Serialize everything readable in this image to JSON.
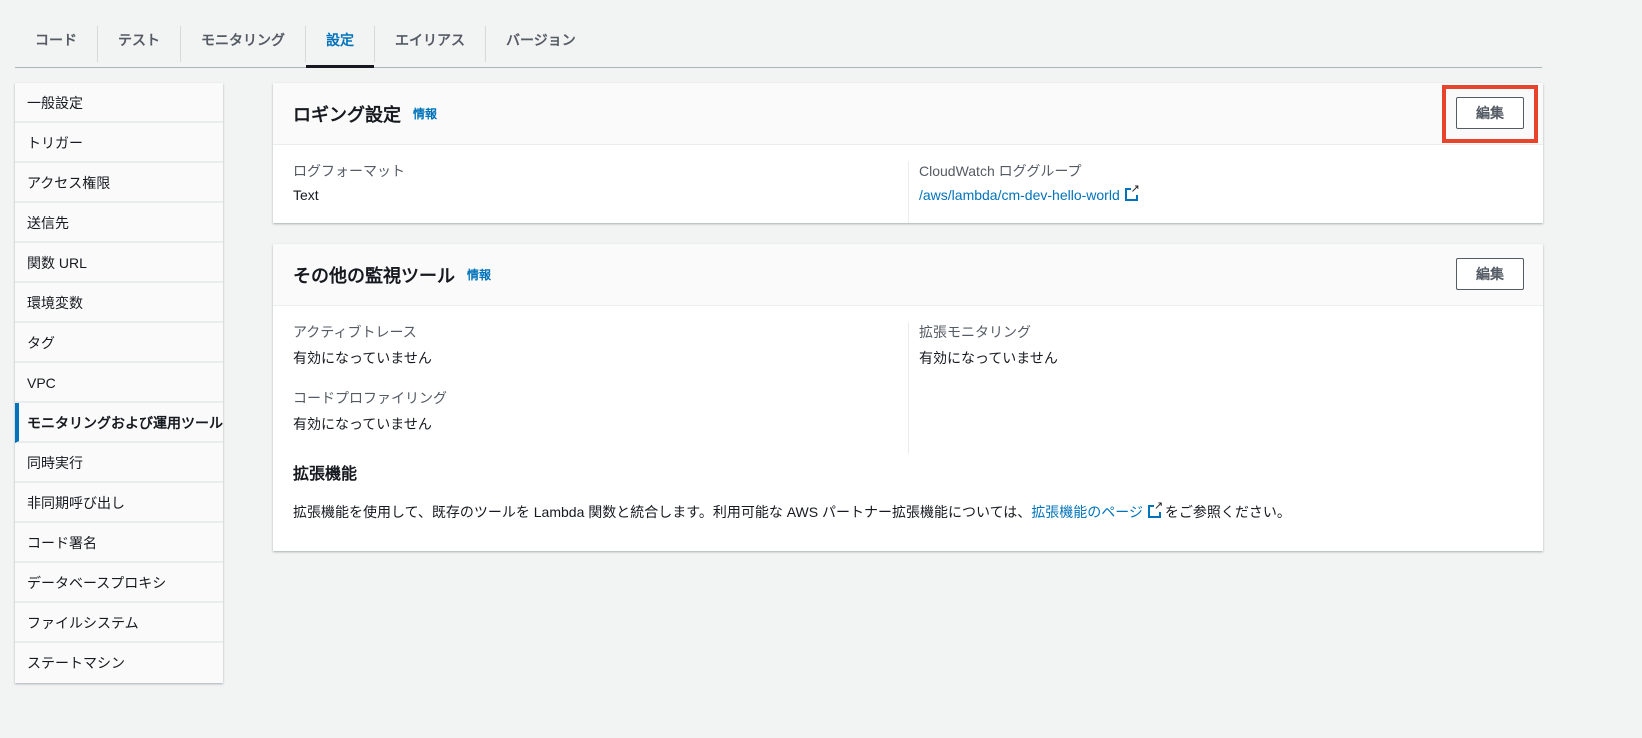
{
  "tabs": [
    "コード",
    "テスト",
    "モニタリング",
    "設定",
    "エイリアス",
    "バージョン"
  ],
  "active_tab": "設定",
  "sidebar": [
    "一般設定",
    "トリガー",
    "アクセス権限",
    "送信先",
    "関数 URL",
    "環境変数",
    "タグ",
    "VPC",
    "モニタリングおよび運用ツール",
    "同時実行",
    "非同期呼び出し",
    "コード署名",
    "データベースプロキシ",
    "ファイルシステム",
    "ステートマシン"
  ],
  "logging": {
    "title": "ロギング設定",
    "info": "情報",
    "edit": "編集",
    "format_label": "ログフォーマット",
    "format_value": "Text",
    "group_label": "CloudWatch ロググループ",
    "group_value": "/aws/lambda/cm-dev-hello-world"
  },
  "monitoring": {
    "title": "その他の監視ツール",
    "info": "情報",
    "edit": "編集",
    "trace_label": "アクティブトレース",
    "trace_value": "有効になっていません",
    "profiling_label": "コードプロファイリング",
    "profiling_value": "有効になっていません",
    "enhanced_label": "拡張モニタリング",
    "enhanced_value": "有効になっていません",
    "ext_title": "拡張機能",
    "ext_text_before": "拡張機能を使用して、既存のツールを Lambda 関数と統合します。利用可能な AWS パートナー拡張機能については、",
    "ext_link": "拡張機能のページ",
    "ext_text_after": " をご参照ください。"
  }
}
